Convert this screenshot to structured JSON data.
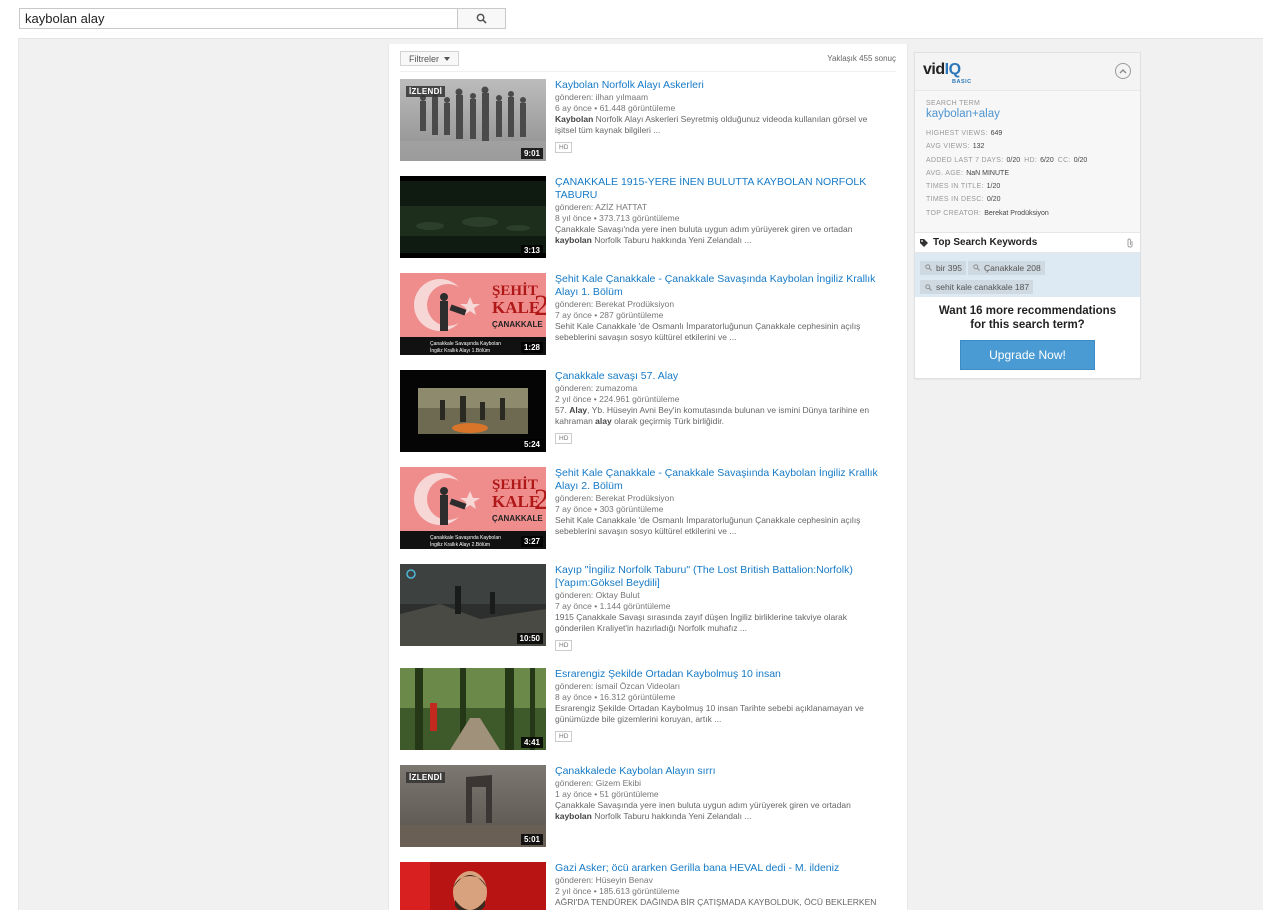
{
  "search": {
    "query": "kaybolan alay"
  },
  "results": {
    "filter_label": "Filtreler",
    "count_text": "Yaklaşık 455 sonuç",
    "videos": [
      {
        "title": "Kaybolan Norfolk Alayı Askerleri",
        "channel": "gönderen: ilhan yılmaam",
        "age": "6 ay önce",
        "views": "61.448 görüntüleme",
        "desc_l1_bold": "Kaybolan",
        "desc_l1_rest": " Norfolk Alayı Askerleri Seyretmiş olduğunuz videoda kullanılan görsel ve",
        "desc_l2": "işitsel tüm kaynak bilgileri ...",
        "duration": "9:01",
        "watched": "İZLENDİ",
        "hd": "HD"
      },
      {
        "title": "ÇANAKKALE 1915-YERE İNEN BULUTTA KAYBOLAN NORFOLK TABURU",
        "channel": "gönderen: AZİZ HATTAT",
        "age": "8 yıl önce",
        "views": "373.713 görüntüleme",
        "desc_l1": "Çanakkale Savaşı'nda yere inen buluta uygun adım yürüyerek giren ve ortadan",
        "desc_l2_bold": "kaybolan",
        "desc_l2_rest": " Norfolk Taburu hakkında Yeni Zelandalı ...",
        "duration": "3:13"
      },
      {
        "title": "Şehit Kale Çanakkale - Çanakkale Savaşında Kaybolan İngiliz Krallık Alayı 1. Bölüm",
        "channel": "gönderen: Berekat Prodüksiyon",
        "age": "7 ay önce",
        "views": "287 görüntüleme",
        "desc_l1": "Sehit Kale Canakkale 'de Osmanlı İmparatorluğunun Çanakkale cephesinin açılış",
        "desc_l2": "sebeblerini savaşın sosyo kültürel etkilerini ve ...",
        "duration": "1:28",
        "thumb_top": "ŞEHİT",
        "thumb_mid": "KALE",
        "thumb_num": "2",
        "thumb_sub": "ÇANAKKALE",
        "thumb_cap1": "Çanakkale Savaşında Kaybolan",
        "thumb_cap2": "İngiliz Krallık Alayı 1.Bölüm"
      },
      {
        "title": "Çanakkale savaşı 57. Alay",
        "channel": "gönderen: zumazoma",
        "age": "2 yıl önce",
        "views": "224.961 görüntüleme",
        "desc_l1_a": "57. ",
        "desc_l1_bold": "Alay",
        "desc_l1_rest": ", Yb. Hüseyin Avni Bey'in komutasında bulunan ve ismini Dünya tarihine en",
        "desc_l2_a": "kahraman ",
        "desc_l2_bold": "alay",
        "desc_l2_rest": " olarak geçirmiş Türk birliğidir.",
        "duration": "5:24",
        "hd": "HD"
      },
      {
        "title": "Şehit Kale Çanakkale - Çanakkale Savaşiında Kaybolan İngiliz Krallık Alayı 2. Bölüm",
        "channel": "gönderen: Berekat Prodüksiyon",
        "age": "7 ay önce",
        "views": "303 görüntüleme",
        "desc_l1": "Sehit Kale Canakkale 'de Osmanlı İmparatorluğunun Çanakkale cephesinin açılış",
        "desc_l2": "sebeblerini savaşın sosyo kültürel etkilerini ve ...",
        "duration": "3:27",
        "thumb_top": "ŞEHİT",
        "thumb_mid": "KALE",
        "thumb_num": "2",
        "thumb_sub": "ÇANAKKALE",
        "thumb_cap1": "Çanakkale Savaşında Kaybolan",
        "thumb_cap2": "İngiliz Krallık Alayı 2.Bölüm"
      },
      {
        "title": "Kayıp \"İngiliz Norfolk Taburu\" (The Lost British Battalion:Norfolk) [Yapım:Göksel Beydili]",
        "channel": "gönderen: Oktay Bulut",
        "age": "7 ay önce",
        "views": "1.144 görüntüleme",
        "desc_l1": "1915 Çanakkale Savaşı sırasında zayıf düşen İngiliz birliklerine takviye olarak",
        "desc_l2": "gönderilen Kraliyet'in hazırladığı Norfolk muhafız ...",
        "duration": "10:50",
        "hd": "HD"
      },
      {
        "title": "Esrarengiz Şekilde Ortadan Kaybolmuş 10 insan",
        "channel": "gönderen: ismail Özcan Videoları",
        "age": "8 ay önce",
        "views": "16.312 görüntüleme",
        "desc_l1": "Esrarengiz Şekilde Ortadan Kaybolmuş 10 insan Tarihte sebebi açıklanamayan ve",
        "desc_l2": "günümüzde bile gizemlerini koruyan, artık ...",
        "duration": "4:41",
        "hd": "HD"
      },
      {
        "title": "Çanakkalede Kaybolan Alayın sırrı",
        "channel": "gönderen: Gizem Ekibi",
        "age": "1 ay önce",
        "views": "51 görüntüleme",
        "desc_l1": "Çanakkale Savaşında yere inen buluta uygun adım yürüyerek giren ve ortadan",
        "desc_l2_bold": "kaybolan",
        "desc_l2_rest": " Norfolk Taburu hakkında Yeni Zelandalı ...",
        "duration": "5:01",
        "watched": "İZLENDİ"
      },
      {
        "title": "Gazi Asker; öcü ararken Gerilla bana HEVAL dedi - M. ildeniz",
        "channel": "gönderen: Hüseyin Benav",
        "age": "2 yıl önce",
        "views": "185.613 görüntüleme",
        "desc_l1": "AĞRI'DA TENDÜREK DAĞINDA BİR ÇATIŞMADA KAYBOLDUK, ÖCÜ BEKLERKEN"
      }
    ]
  },
  "vidiq": {
    "logo_vid": "vid",
    "logo_iq": "IQ",
    "logo_basic": "BASIC",
    "search_term_label": "SEARCH TERM",
    "search_term": "kaybolan+alay",
    "highest_views_label": "HIGHEST VIEWS:",
    "highest_views": "649",
    "avg_views_label": "AVG VIEWS:",
    "avg_views": "132",
    "added_label": "ADDED LAST 7 DAYS:",
    "added": "0/20",
    "hd_label": "HD:",
    "hd": "6/20",
    "cc_label": "CC:",
    "cc": "0/20",
    "avg_age_label": "AVG. AGE:",
    "avg_age": "NaN MINUTE",
    "in_title_label": "TIMES IN TITLE:",
    "in_title": "1/20",
    "in_desc_label": "TIMES IN DESC:",
    "in_desc": "0/20",
    "top_creator_label": "TOP CREATOR:",
    "top_creator": "Berekat Prodüksiyon",
    "keywords_title": "Top Search Keywords",
    "keywords": [
      "bir 395",
      "Çanakkale 208",
      "sehit kale canakkale 187"
    ],
    "cta_line1": "Want 16 more recommendations",
    "cta_line2": "for this search term?",
    "upgrade_label": "Upgrade Now!"
  },
  "colors": {
    "link": "#167ac6",
    "upgrade": "#4a9ad4",
    "keyword_bg": "#dde9f3"
  }
}
